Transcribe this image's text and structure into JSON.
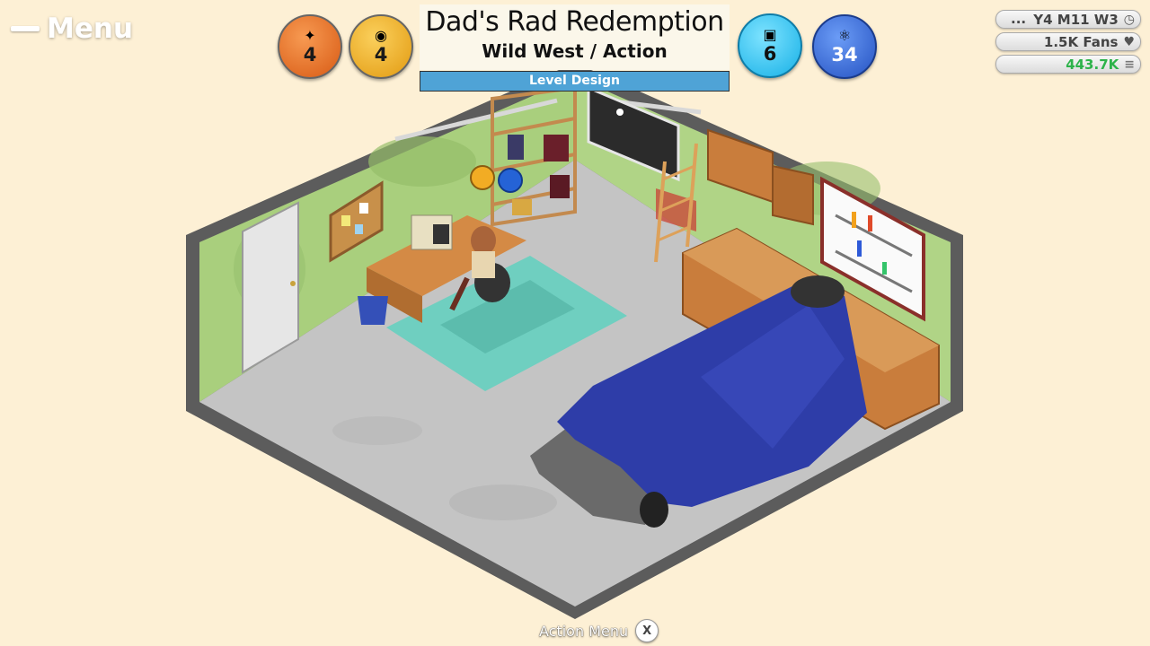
{
  "menu": {
    "label": "Menu"
  },
  "stats": {
    "design": {
      "value": "4",
      "icon": "design-icon"
    },
    "tech": {
      "value": "4",
      "icon": "palette-icon"
    },
    "bugs": {
      "value": "6",
      "icon": "chip-icon"
    },
    "research": {
      "value": "34",
      "icon": "atom-icon"
    }
  },
  "project": {
    "title": "Dad's Rad Redemption",
    "genre": "Wild West / Action",
    "phase": "Level Design",
    "progress": 1.0
  },
  "status": {
    "dots": "...",
    "date": "Y4 M11 W3",
    "fans": "1.5K Fans",
    "cash": "443.7K"
  },
  "footer": {
    "action_label": "Action Menu",
    "action_key": "X"
  },
  "colors": {
    "background": "#fdf0d5",
    "wall": "#a9cf7d",
    "floor": "#c8c8c8",
    "rug": "#6fcfc0",
    "car_cover": "#2e3da8",
    "cash": "#2db34a"
  }
}
